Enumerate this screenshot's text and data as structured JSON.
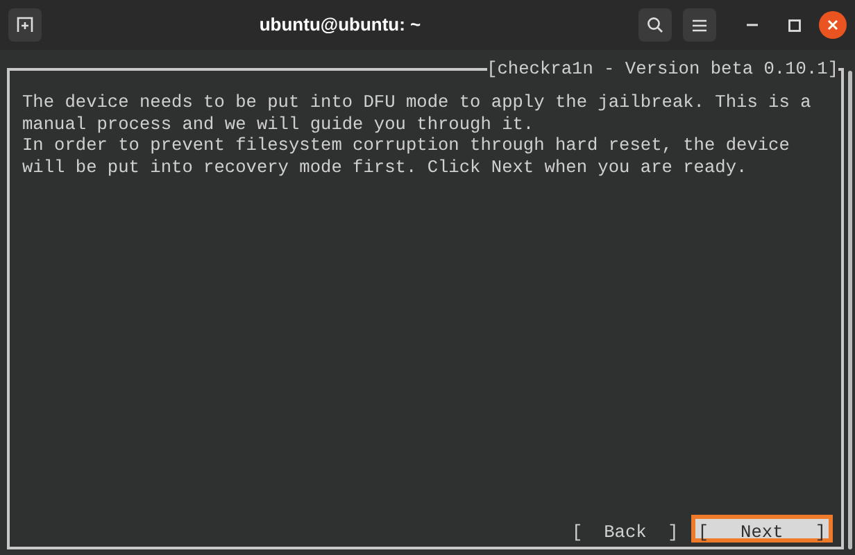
{
  "window": {
    "title": "ubuntu@ubuntu: ~"
  },
  "dialog": {
    "title": "[checkra1n - Version beta 0.10.1]",
    "lines": [
      "The device needs to be put into DFU mode to apply the jailbreak. This is a",
      "manual process and we will guide you through it.",
      "In order to prevent filesystem corruption through hard reset, the device",
      "will be put into recovery mode first. Click Next when you are ready."
    ],
    "buttons": [
      {
        "label": "[  Back  ]",
        "selected": false
      },
      {
        "label": "[   Next   ]",
        "selected": true
      }
    ]
  }
}
